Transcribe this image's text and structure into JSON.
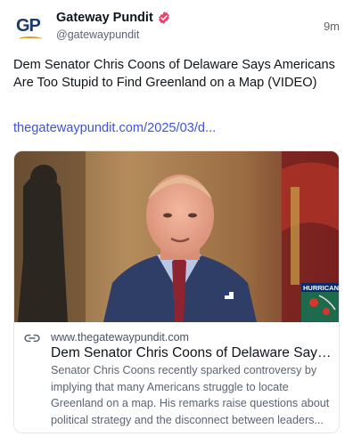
{
  "account": {
    "display_name": "Gateway Pundit",
    "handle": "@gatewaypundit",
    "avatar_text": "GP",
    "verified_icon": "verified-badge-icon",
    "verified_color": "#e8446b"
  },
  "post": {
    "time": "9m",
    "text": "Dem Senator Chris Coons of Delaware Says Americans Are Too Stupid to Find Greenland on a Map (VIDEO)",
    "link_text": "thegatewaypundit.com/2025/03/d...",
    "link_color": "#3d54d8"
  },
  "card": {
    "image_overlay_text": "HURRICANE",
    "link_icon": "link-chain-icon",
    "domain": "www.thegatewaypundit.com",
    "title": "Dem Senator Chris Coons of Delaware Says A...",
    "description": "Senator Chris Coons recently sparked controversy by implying that many Americans struggle to locate Greenland on a map. His remarks raise questions about political strategy and the disconnect between leaders..."
  }
}
